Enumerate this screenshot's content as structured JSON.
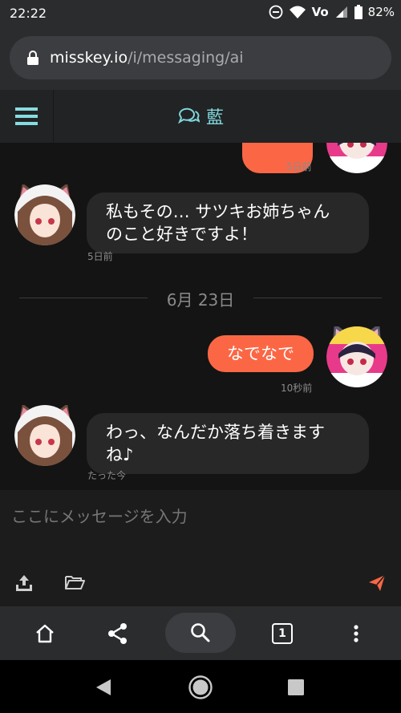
{
  "status_bar": {
    "time": "22:22",
    "battery": "82%",
    "network": "Vo"
  },
  "browser": {
    "url_host": "misskey.io",
    "url_path": "/i/messaging/ai",
    "tab_count": "1"
  },
  "header": {
    "title": "藍",
    "icon": "chat-bubbles-icon"
  },
  "messages": [
    {
      "id": "m0",
      "side": "out",
      "text": "",
      "time": "5日前"
    },
    {
      "id": "m1",
      "side": "in",
      "text_line1": "私もその… サツキお姉ちゃん",
      "text_line2": "のこと好きですよ！",
      "time": "5日前"
    },
    {
      "id": "m2",
      "side": "out",
      "text": "なでなで",
      "time": "10秒前"
    },
    {
      "id": "m3",
      "side": "in",
      "text_line1": "わっ、なんだか落ち着きます",
      "text_line2": "ね♪",
      "time": "たった今"
    }
  ],
  "date_separator": "6月 23日",
  "composer": {
    "placeholder": "ここにメッセージを入力"
  },
  "colors": {
    "accent": "#fb6745",
    "header_text": "#7fd6da",
    "bubble_in": "#282828"
  }
}
